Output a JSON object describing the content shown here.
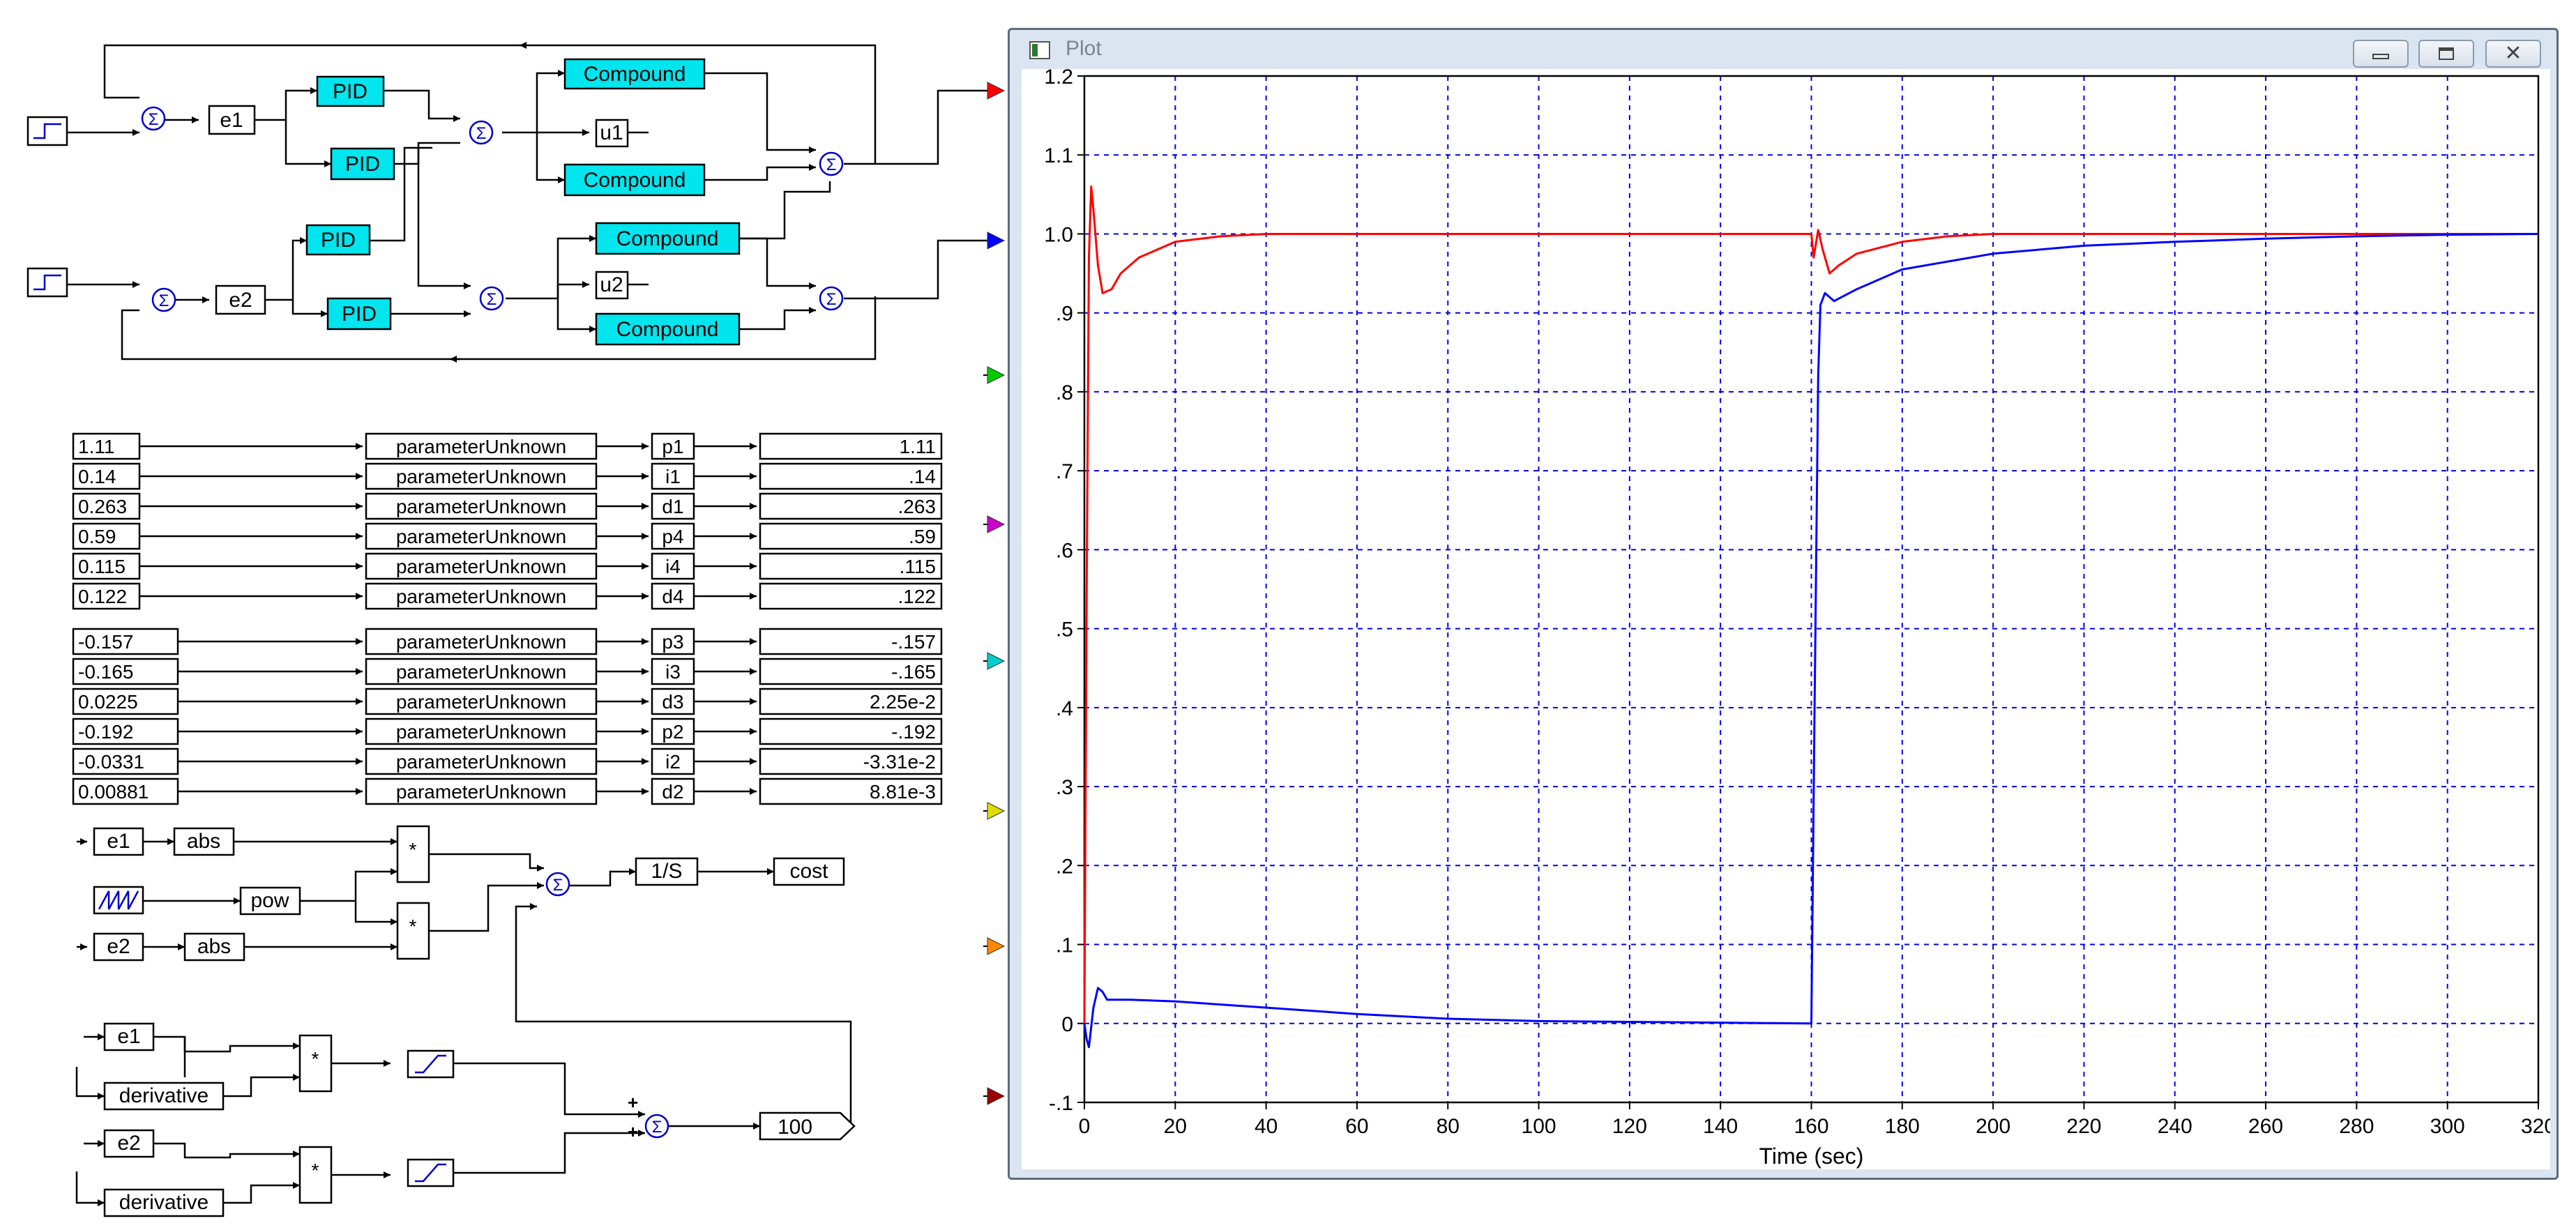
{
  "diagram": {
    "pid_label": "PID",
    "compound_label": "Compound",
    "signals": {
      "e1": "e1",
      "e2": "e2",
      "u1": "u1",
      "u2": "u2"
    },
    "parameter_block_label": "parameterUnknown",
    "parameters_group1": [
      {
        "value": "1.11",
        "name": "p1",
        "display": "1.11"
      },
      {
        "value": "0.14",
        "name": "i1",
        "display": ".14"
      },
      {
        "value": "0.263",
        "name": "d1",
        "display": ".263"
      },
      {
        "value": "0.59",
        "name": "p4",
        "display": ".59"
      },
      {
        "value": "0.115",
        "name": "i4",
        "display": ".115"
      },
      {
        "value": "0.122",
        "name": "d4",
        "display": ".122"
      }
    ],
    "parameters_group2": [
      {
        "value": "-0.157",
        "name": "p3",
        "display": "-.157"
      },
      {
        "value": "-0.165",
        "name": "i3",
        "display": "-.165"
      },
      {
        "value": "0.0225",
        "name": "d3",
        "display": "2.25e-2"
      },
      {
        "value": "-0.192",
        "name": "p2",
        "display": "-.192"
      },
      {
        "value": "-0.0331",
        "name": "i2",
        "display": "-3.31e-2"
      },
      {
        "value": "0.00881",
        "name": "d2",
        "display": "8.81e-3"
      }
    ],
    "cost": {
      "abs_label": "abs",
      "pow_label": "pow",
      "mult_label": "*",
      "integrator_label": "1/S",
      "cost_label": "cost"
    },
    "penalty": {
      "derivative_label": "derivative",
      "gain_label": "100",
      "plus_sign": "+"
    }
  },
  "window": {
    "title": "Plot",
    "minimize_icon": "minimize-icon",
    "restore_icon": "restore-icon",
    "close_icon": "close-icon"
  },
  "chart_data": {
    "type": "line",
    "title": "",
    "xlabel": "Time (sec)",
    "ylabel": "",
    "xlim": [
      0,
      320
    ],
    "ylim": [
      -0.1,
      1.2
    ],
    "xticks": [
      0,
      20,
      40,
      60,
      80,
      100,
      120,
      140,
      160,
      180,
      200,
      220,
      240,
      260,
      280,
      300,
      320
    ],
    "xtick_labels": [
      "0",
      "20",
      "40",
      "60",
      "80",
      "100",
      "120",
      "140",
      "160",
      "180",
      "200",
      "220",
      "240",
      "260",
      "280",
      "300",
      "320"
    ],
    "yticks": [
      -0.1,
      0,
      0.1,
      0.2,
      0.3,
      0.4,
      0.5,
      0.6,
      0.7,
      0.8,
      0.9,
      1.0,
      1.1,
      1.2
    ],
    "ytick_labels": [
      "-.1",
      "0",
      ".1",
      ".2",
      ".3",
      ".4",
      ".5",
      ".6",
      ".7",
      ".8",
      ".9",
      "1.0",
      "1.1",
      "1.2"
    ],
    "grid": true,
    "series": [
      {
        "color": "#ff0000",
        "x": [
          0,
          0.5,
          1,
          1.5,
          2,
          3,
          4,
          6,
          8,
          12,
          20,
          30,
          40,
          60,
          100,
          160,
          160.5,
          161.5,
          162.5,
          164,
          166,
          170,
          180,
          190,
          200,
          240,
          320
        ],
        "y": [
          0,
          0.55,
          0.97,
          1.06,
          1.03,
          0.96,
          0.925,
          0.93,
          0.95,
          0.97,
          0.99,
          0.997,
          1.0,
          1.0,
          1.0,
          1.0,
          0.97,
          1.005,
          0.98,
          0.95,
          0.96,
          0.975,
          0.99,
          0.997,
          1.0,
          1.0,
          1.0
        ]
      },
      {
        "color": "#0000ff",
        "x": [
          0,
          0.5,
          1,
          2,
          3,
          4,
          5,
          7,
          10,
          20,
          40,
          60,
          80,
          100,
          120,
          140,
          159,
          160,
          160.7,
          161.5,
          162,
          163,
          165,
          170,
          180,
          200,
          220,
          240,
          260,
          280,
          300,
          320
        ],
        "y": [
          0,
          -0.02,
          -0.03,
          0.02,
          0.045,
          0.04,
          0.03,
          0.03,
          0.03,
          0.028,
          0.02,
          0.012,
          0.006,
          0.003,
          0.002,
          0.001,
          0.0,
          0.0,
          0.4,
          0.82,
          0.91,
          0.925,
          0.915,
          0.93,
          0.955,
          0.975,
          0.985,
          0.99,
          0.994,
          0.997,
          0.999,
          1.0
        ]
      }
    ],
    "channel_marker_colors": [
      "#ff0000",
      "#0000ff",
      "#00cc00",
      "#cc00cc",
      "#00cccc",
      "#dddd00",
      "#ff8800",
      "#990000"
    ]
  }
}
